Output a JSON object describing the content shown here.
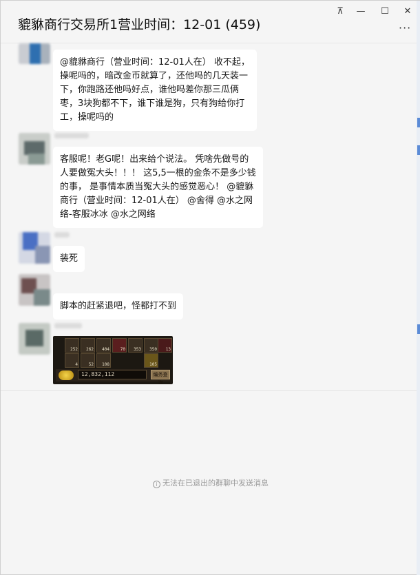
{
  "window": {
    "title": "貔貅商行交易所1营业时间：12-01 (459)",
    "controls": {
      "pin": "⊼",
      "minimize": "—",
      "maximize": "☐",
      "close": "✕"
    },
    "more_label": "···"
  },
  "messages": [
    {
      "lines": [
        "@貔貅商行（营业时间：12-01人在） 收不起，",
        "操呢吗的，暗改金币就算了，还他吗的几天装一",
        "下，你跑路还他吗好点，谁他吗差你那三瓜俩",
        "枣，3块狗都不下，谁下谁是狗，只有狗给你打",
        "工，操呢吗的"
      ]
    },
    {
      "lines": [
        "客服呢！老G呢！出来给个说法。 凭啥先做号的",
        "人要做冤大头！！！ 这5,5一根的金条不是多少钱",
        "的事， 是事情本质当冤大头的感觉恶心！ @貔貅",
        "商行（营业时间：12-01人在） @舍得 @水之网",
        "络-客服冰冰 @水之网络"
      ]
    },
    {
      "lines": [
        "装死"
      ]
    },
    {
      "lines": [
        "脚本的赶紧退吧，怪都打不到"
      ]
    }
  ],
  "game_image": {
    "item_counts_row1": [
      "252",
      "262",
      "404",
      "70",
      "353",
      "350",
      "13"
    ],
    "item_counts_row2": [
      "4",
      "52",
      "108",
      "",
      "",
      "105",
      ""
    ],
    "gold_amount": "12,832,112",
    "gold_button": "编务查询"
  },
  "footer": {
    "notice": "无法在已退出的群聊中发送消息",
    "icon": "info-icon"
  }
}
